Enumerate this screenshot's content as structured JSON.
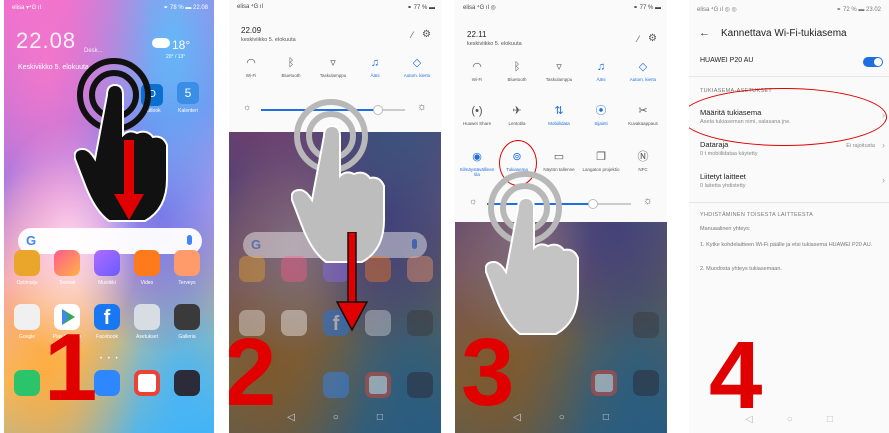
{
  "steps": [
    "1",
    "2",
    "3",
    "4"
  ],
  "panel1": {
    "status_left": "elisa ▾⁴G ıl",
    "status_right": "⚭ 78 % ▬ 22.08",
    "clock": "22.08",
    "clock_city": "Desk...",
    "date": "Keskiviikko 5. elokuuta",
    "weather_temp": "18°",
    "weather_sub": "20° / 13°",
    "outlook_label": "Outlook",
    "calendar_day": "5",
    "calendar_label": "Kalenteri",
    "search_logo": "G",
    "apps_row1": [
      "Optimoija",
      "Teemat",
      "Musiikki",
      "Video",
      "Terveys"
    ],
    "apps_row2": [
      "Google",
      "Play Kauppa",
      "Facebook",
      "Asetukset",
      "Galleria"
    ]
  },
  "panel2": {
    "status_left": "elisa ⁴G ıl",
    "status_right": "⚭ 77 % ▬",
    "time": "22.09",
    "date": "keskiviikko 5. elokuuta",
    "tiles": [
      "Wi-Fi",
      "Bluetooth",
      "Taskulamppu",
      "Ääni",
      "Autom. kierto"
    ]
  },
  "panel3": {
    "status_left": "elisa ⁴G ıl ◎",
    "status_right": "⚭ 77 % ▬",
    "time": "22.11",
    "date": "keskiviikko 5. elokuuta",
    "tiles_row1": [
      "Wi-Fi",
      "Bluetooth",
      "Taskulamppu",
      "Ääni",
      "Autom. kierto"
    ],
    "tiles_row2": [
      "Huawei Share",
      "Lentotila",
      "Mobiilidata",
      "Sijainti",
      "Kuvakaappaus"
    ],
    "tiles_row3": [
      "Silmäystävällinen tila",
      "Tukiasema",
      "Näytön tallenne",
      "Langaton projektio",
      "NFC"
    ]
  },
  "panel4": {
    "status_left": "elisa ⁴G ıl ◎ ◎",
    "status_right": "⚭ 72 % ▬ 23.02",
    "back": "←",
    "title": "Kannettava Wi-Fi-tukiasema",
    "device_name": "HUAWEI P20 AU",
    "section1": "TUKIASEMA-ASETUKSET",
    "row1_label": "Määritä tukiasema",
    "row1_sub": "Aseta tukiaseman nimi, salasana jne.",
    "row2_label": "Dataraja",
    "row2_sub": "0 t mobiilidataa käytetty",
    "row2_value": "Ei rajoitusta",
    "row3_label": "Liitetyt laitteet",
    "row3_sub": "0 laitetta yhdistetty",
    "section2": "YHDISTÄMINEN TOISESTA LAITTEESTA",
    "manual": "Manuaalinen yhteys:",
    "step1": "1. Kytke kohdelaitteen Wi-Fi päälle ja etsi tukiasema HUAWEI P20 AU.",
    "step2": "2. Muodosta yhteys tukiasemaan."
  },
  "colors": {
    "accent": "#1e6fe0",
    "step_red": "#e00000"
  },
  "nav": {
    "back": "◁",
    "home": "○",
    "recent": "□"
  }
}
